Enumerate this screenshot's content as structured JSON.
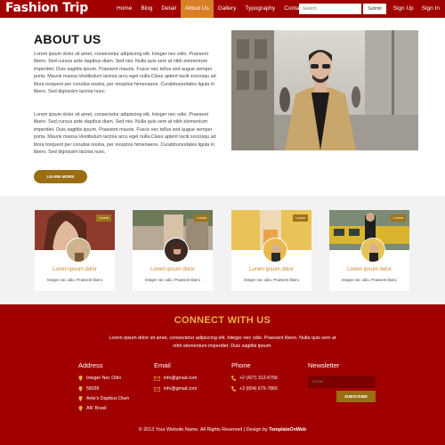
{
  "nav": {
    "brand": "Fashion Trip",
    "links": [
      "Home",
      "Blog",
      "Detail",
      "About Us",
      "Gallery",
      "Typography",
      "Contact"
    ],
    "active_index": 3,
    "search_placeholder": "Search",
    "search_button": "Submit",
    "sign_up": "Sign Up",
    "sign_in": "Sign In"
  },
  "about": {
    "title": "ABOUT US",
    "para1": "Lorem ipsum dolor sit amet, consectetur adipiscing elit. Integer nec odio. Praesent libero. Sed cursus ante dapibus diam. Sed nisi. Nulla quis sem at nibh elementum imperdiet. Duis sagittis ipsum. Praesent mauris. Fusce nec tellus sed augue semper porta. Mauris massa.Vestibulum lacinia arcu eget nulla.Class aptent taciti sociosqu ad litora torquent per conubia nostra, per inceptos himenaeos. Curabitursodales ligula in libero. Sed dignissim lacinia nunc.",
    "para2": "Lorem ipsum dolor sit amet, consectetur adipiscing elit. Integer nec odio. Praesent libero. Sed cursus ante dapibus diam. Sed nisi. Nulla quis sem at nibh elementum imperdiet. Duis sagittis ipsum. Praesent mauris. Fusce nec tellus sed augue semper porta. Mauris massa.Vestibulum lacinia arcu eget nulla.Class aptent taciti sociosqu ad litora torquent per conubia nostra, per inceptos himenaeos. Curabitursodales ligula in libero. Sed dignissim lacinia nunc.",
    "button": "LEARN MORE"
  },
  "cards": [
    {
      "badge": "Lorem",
      "title": "Lorem ipsum dolor",
      "subtitle": "Integer nec odio. Praesent libero"
    },
    {
      "badge": "Lorem",
      "title": "Lorem ipsum dolor",
      "subtitle": "Integer nec odio. Praesent libero"
    },
    {
      "badge": "Lorem",
      "title": "Lorem ipsum dolor",
      "subtitle": "Integer nec odio. Praesent libero"
    },
    {
      "badge": "Lorem",
      "title": "Lorem ipsum dolor",
      "subtitle": "Integer nec odio. Praesent libero"
    }
  ],
  "footer": {
    "connect_title": "CONNECT WITH US",
    "connect_text": "Lorem ipsum dolor sit amet, consectetur adipiscing elit. Integer nec odio. Praesent libero. Nulla quis sem at nibh elementum imperdiet. Duis sagittis ipsum.",
    "address": {
      "title": "Address",
      "lines": [
        "Integer Nec Odio",
        "58039",
        "Ante's Dapibus Diam",
        "AIF Brasil"
      ]
    },
    "email": {
      "title": "Email",
      "lines": [
        "info@gmail.com",
        "info@gmail.com"
      ]
    },
    "phone": {
      "title": "Phone",
      "lines": [
        "+2 (427) 312-6756",
        "+3 (654) 675-7865"
      ]
    },
    "newsletter": {
      "title": "Newsletter",
      "placeholder": "Email",
      "button": "SUBSCRIBE"
    },
    "copyright_prefix": "© 2013 Your Website Name. All Rights Reserved | Design by ",
    "copyright_link": "TemplateOnWeb"
  },
  "colors": {
    "brand_red": "#a00000",
    "accent_orange": "#d97f26",
    "gold": "#9a6e12",
    "title_gold": "#e8b14a"
  }
}
